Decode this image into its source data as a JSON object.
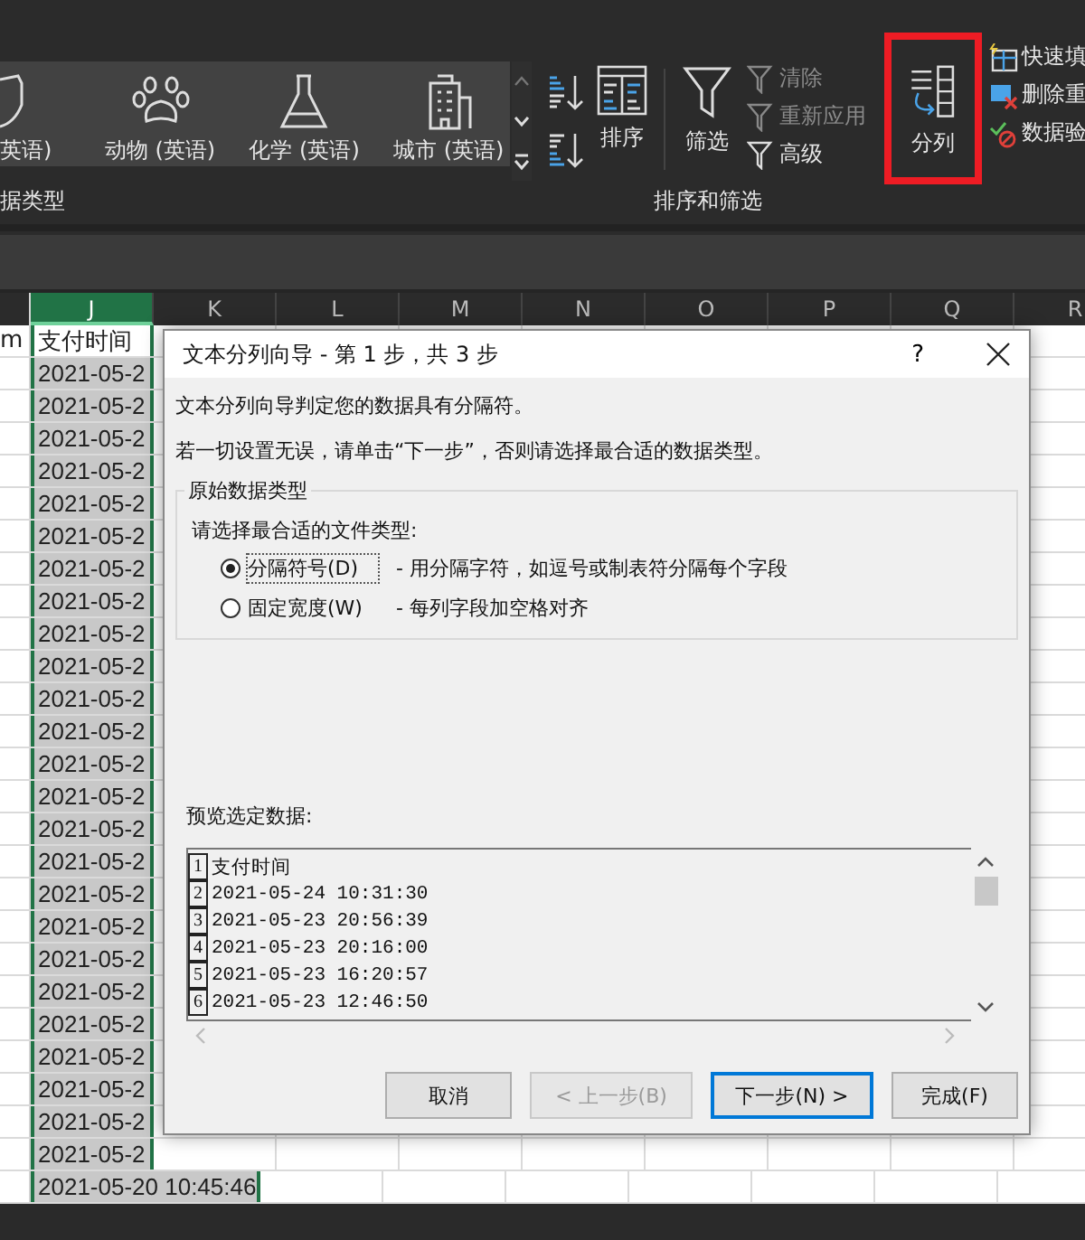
{
  "ribbon": {
    "gallery_items": [
      {
        "label": "英语)"
      },
      {
        "label": "动物 (英语)"
      },
      {
        "label": "化学 (英语)"
      },
      {
        "label": "城市 (英语)"
      }
    ],
    "gallery_group_label": "据类型",
    "sort_filter": {
      "sort_label": "排序",
      "filter_label": "筛选",
      "commands": [
        {
          "label": "清除",
          "disabled": true
        },
        {
          "label": "重新应用",
          "disabled": true
        },
        {
          "label": "高级",
          "disabled": false
        }
      ],
      "group_label": "排序和筛选"
    },
    "data_tools": {
      "split_label": "分列",
      "highlighted": true,
      "commands": [
        {
          "label": "快速填"
        },
        {
          "label": "删除重"
        },
        {
          "label": "数据验"
        }
      ]
    }
  },
  "sheet": {
    "left_column_text": "m",
    "columns": [
      {
        "label": "J",
        "selected": true
      },
      {
        "label": "K",
        "selected": false
      },
      {
        "label": "L",
        "selected": false
      },
      {
        "label": "M",
        "selected": false
      },
      {
        "label": "N",
        "selected": false
      },
      {
        "label": "O",
        "selected": false
      },
      {
        "label": "P",
        "selected": false
      },
      {
        "label": "Q",
        "selected": false
      },
      {
        "label": "R",
        "selected": false
      }
    ],
    "rows": [
      {
        "text": "支付时间",
        "selected": false
      },
      {
        "text": "2021-05-2",
        "selected": true
      },
      {
        "text": "2021-05-2",
        "selected": true
      },
      {
        "text": "2021-05-2",
        "selected": true
      },
      {
        "text": "2021-05-2",
        "selected": true
      },
      {
        "text": "2021-05-2",
        "selected": true
      },
      {
        "text": "2021-05-2",
        "selected": true
      },
      {
        "text": "2021-05-2",
        "selected": true
      },
      {
        "text": "2021-05-2",
        "selected": true
      },
      {
        "text": "2021-05-2",
        "selected": true
      },
      {
        "text": "2021-05-2",
        "selected": true
      },
      {
        "text": "2021-05-2",
        "selected": true
      },
      {
        "text": "2021-05-2",
        "selected": true
      },
      {
        "text": "2021-05-2",
        "selected": true
      },
      {
        "text": "2021-05-2",
        "selected": true
      },
      {
        "text": "2021-05-2",
        "selected": true
      },
      {
        "text": "2021-05-2",
        "selected": true
      },
      {
        "text": "2021-05-2",
        "selected": true
      },
      {
        "text": "2021-05-2",
        "selected": true
      },
      {
        "text": "2021-05-2",
        "selected": true
      },
      {
        "text": "2021-05-2",
        "selected": true
      },
      {
        "text": "2021-05-2",
        "selected": true
      },
      {
        "text": "2021-05-2",
        "selected": true
      },
      {
        "text": "2021-05-2",
        "selected": true
      },
      {
        "text": "2021-05-2",
        "selected": true
      },
      {
        "text": "2021-05-2",
        "selected": true
      },
      {
        "text": "2021-05-20 10:45:46",
        "selected": true
      }
    ]
  },
  "dialog": {
    "title": "文本分列向导 - 第 1 步，共 3 步",
    "help": "?",
    "intro": "文本分列向导判定您的数据具有分隔符。",
    "instruction": "若一切设置无误，请单击“下一步”，否则请选择最合适的数据类型。",
    "group_title": "原始数据类型",
    "prompt": "请选择最合适的文件类型:",
    "options": [
      {
        "label": "分隔符号(D)",
        "description": "- 用分隔字符，如逗号或制表符分隔每个字段",
        "selected": true
      },
      {
        "label": "固定宽度(W)",
        "description": "- 每列字段加空格对齐",
        "selected": false
      }
    ],
    "preview_label": "预览选定数据:",
    "preview_rows": [
      {
        "number": "1",
        "text": "支付时间"
      },
      {
        "number": "2",
        "text": "2021-05-24 10:31:30"
      },
      {
        "number": "3",
        "text": "2021-05-23 20:56:39"
      },
      {
        "number": "4",
        "text": "2021-05-23 20:16:00"
      },
      {
        "number": "5",
        "text": "2021-05-23 16:20:57"
      },
      {
        "number": "6",
        "text": "2021-05-23 12:46:50"
      }
    ],
    "buttons": [
      {
        "label": "取消",
        "disabled": false,
        "default": false
      },
      {
        "label": "< 上一步(B)",
        "disabled": true,
        "default": false
      },
      {
        "label": "下一步(N) >",
        "disabled": false,
        "default": true
      },
      {
        "label": "完成(F)",
        "disabled": false,
        "default": false
      }
    ]
  }
}
